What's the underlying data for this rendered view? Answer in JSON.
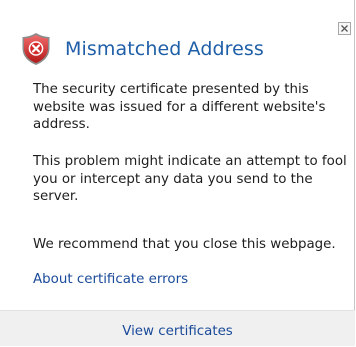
{
  "dialog": {
    "title": "Mismatched Address",
    "paragraph1": "The security certificate presented by this website was issued for a different website's address.",
    "paragraph2": "This problem might indicate an attempt to fool you or intercept any data you send to the server.",
    "paragraph3": "We recommend that you close this webpage.",
    "about_link": "About certificate errors",
    "view_certificates": "View certificates",
    "icon": "shield-error-icon",
    "close_icon": "close-icon",
    "colors": {
      "title": "#1f5fa8",
      "link": "#1a4a9a",
      "shield_red": "#d32a2a",
      "footer_bg": "#f0f0f0"
    }
  }
}
